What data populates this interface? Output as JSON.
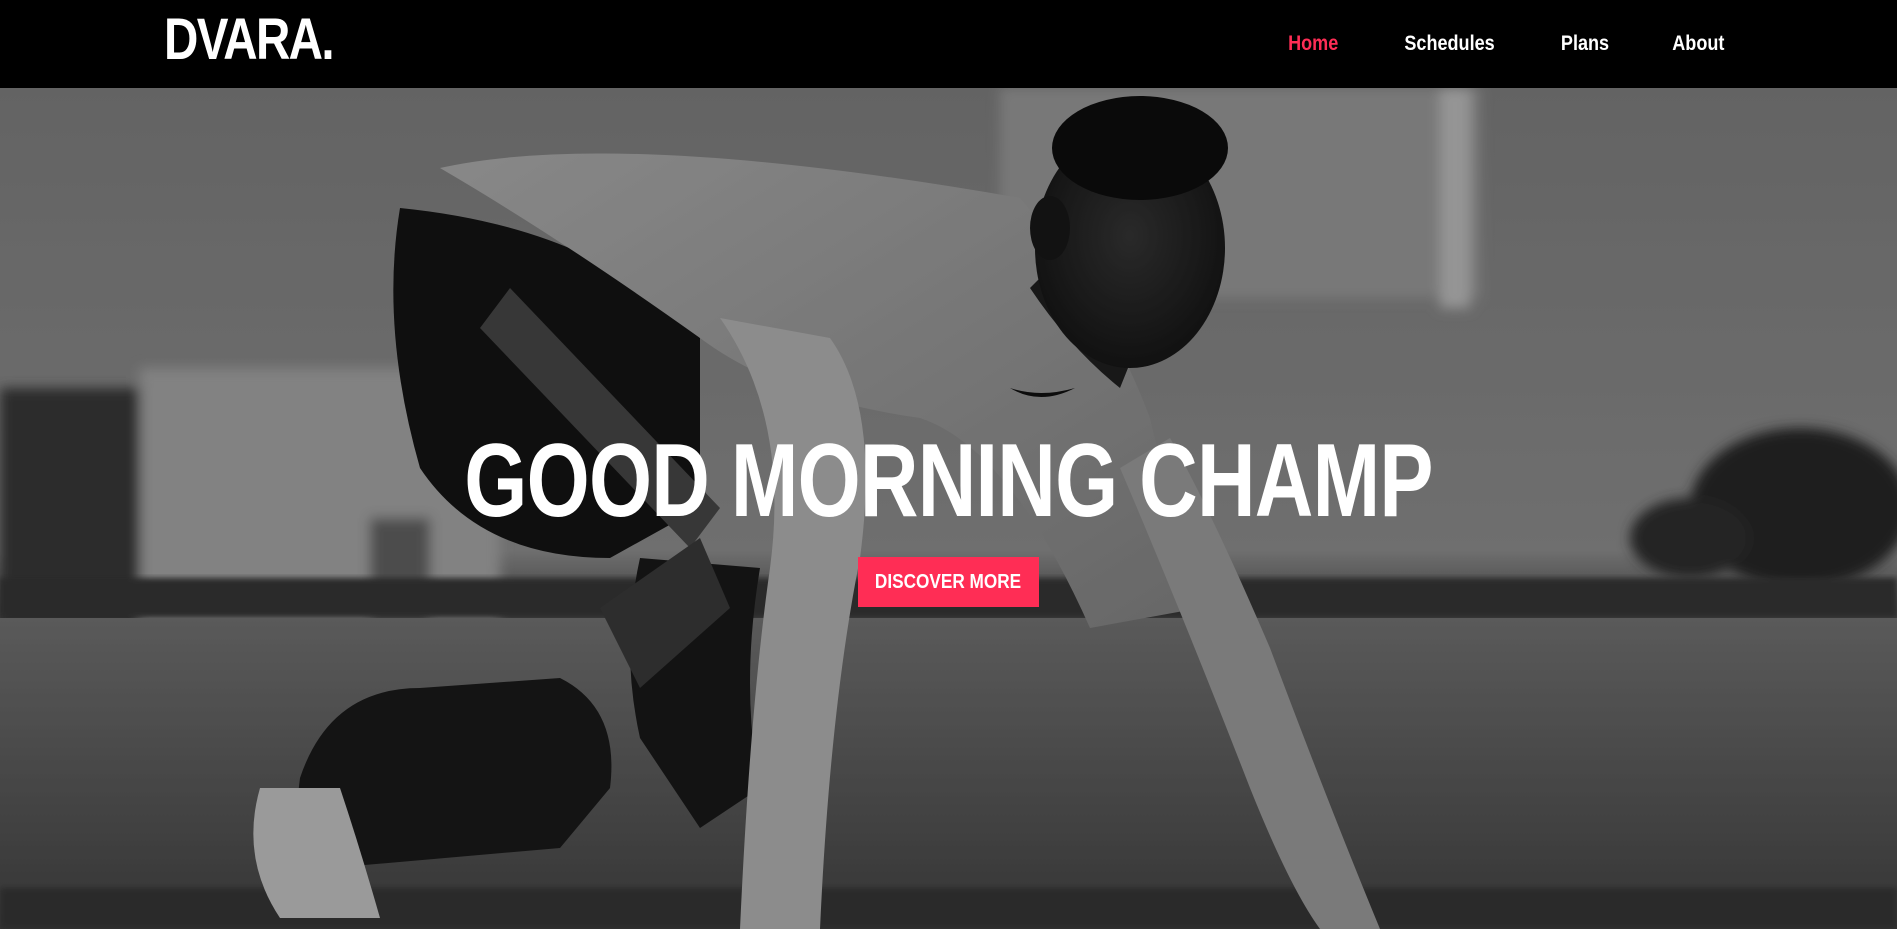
{
  "header": {
    "logo": "DVARA.",
    "nav": [
      {
        "label": "Home",
        "active": true
      },
      {
        "label": "Schedules",
        "active": false
      },
      {
        "label": "Plans",
        "active": false
      },
      {
        "label": "About",
        "active": false
      }
    ]
  },
  "hero": {
    "title": "GOOD MORNING CHAMP",
    "cta_label": "DISCOVER MORE",
    "image_subject": "grayscale photo of a sprinter in starting position on a track"
  },
  "colors": {
    "accent": "#ff2d55",
    "nav_background": "#000000",
    "text": "#ffffff"
  }
}
